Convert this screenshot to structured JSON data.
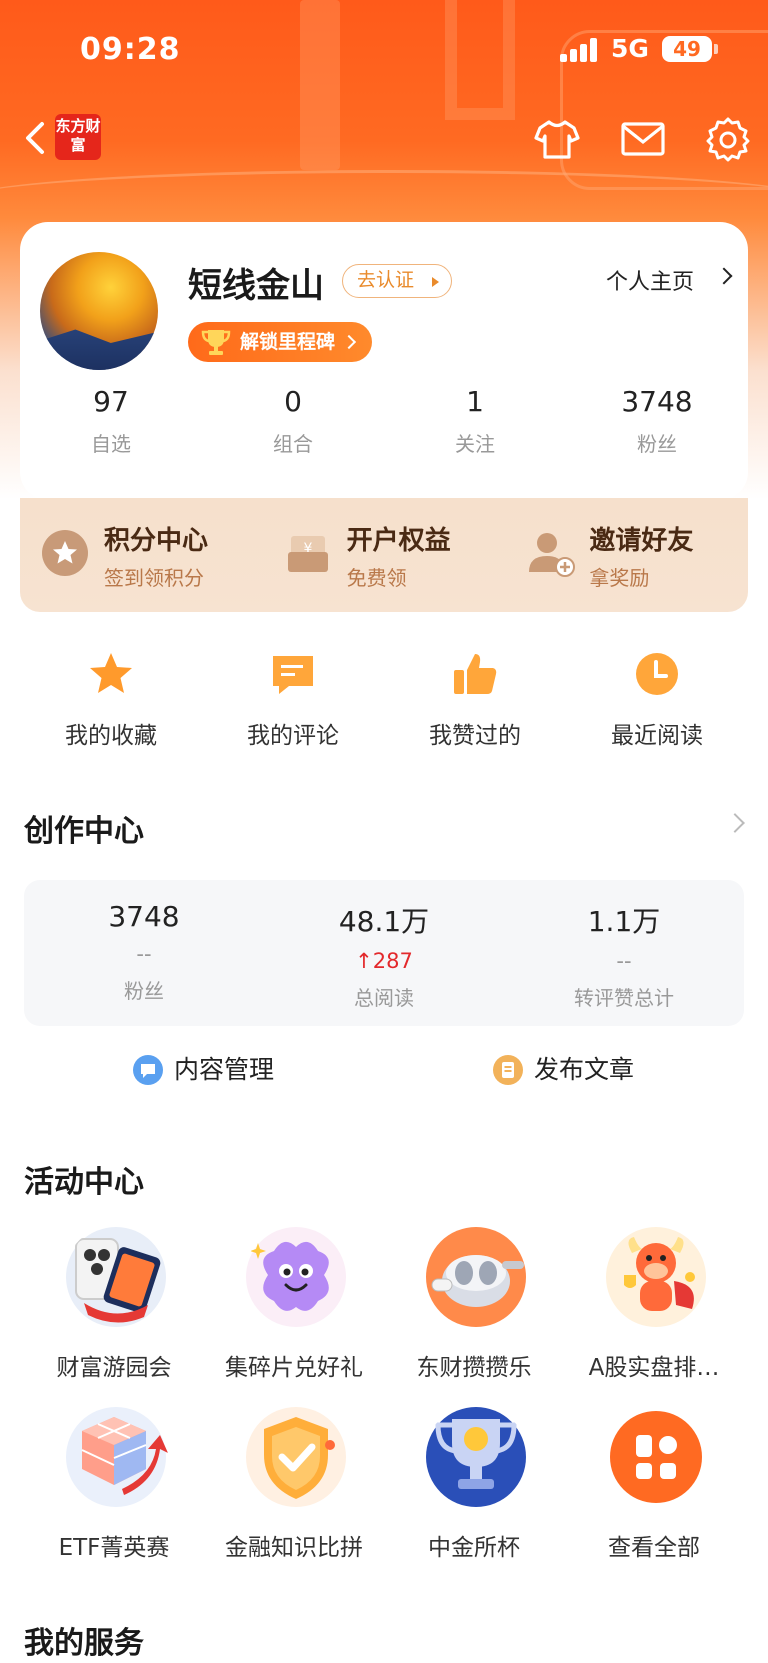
{
  "status_bar": {
    "time": "09:28",
    "network": "5G",
    "battery": "49"
  },
  "nav": {
    "logo_text": "东方财富",
    "icons": [
      "back-icon",
      "tshirt-icon",
      "mail-icon",
      "settings-icon"
    ]
  },
  "profile": {
    "username": "短线金山",
    "verify_label": "去认证",
    "homepage_label": "个人主页",
    "milestone_label": "解锁里程碑",
    "stats": [
      {
        "value": "97",
        "label": "自选"
      },
      {
        "value": "0",
        "label": "组合"
      },
      {
        "value": "1",
        "label": "关注"
      },
      {
        "value": "3748",
        "label": "粉丝"
      }
    ]
  },
  "benefits": [
    {
      "title": "积分中心",
      "sub": "签到领积分",
      "icon": "points-icon"
    },
    {
      "title": "开户权益",
      "sub": "免费领",
      "icon": "gift-box-icon"
    },
    {
      "title": "邀请好友",
      "sub": "拿奖励",
      "icon": "invite-user-icon"
    }
  ],
  "quick_links": [
    {
      "label": "我的收藏",
      "icon": "star-icon"
    },
    {
      "label": "我的评论",
      "icon": "comment-icon"
    },
    {
      "label": "我赞过的",
      "icon": "thumbs-up-icon"
    },
    {
      "label": "最近阅读",
      "icon": "clock-icon"
    }
  ],
  "creator": {
    "title": "创作中心",
    "stats": [
      {
        "value": "3748",
        "delta": "--",
        "label": "粉丝"
      },
      {
        "value": "48.1万",
        "delta": "↑287",
        "label": "总阅读"
      },
      {
        "value": "1.1万",
        "delta": "--",
        "label": "转评赞总计"
      }
    ],
    "actions": [
      {
        "label": "内容管理",
        "color": "#5aa0f0"
      },
      {
        "label": "发布文章",
        "color": "#f2b25a"
      }
    ]
  },
  "activity": {
    "title": "活动中心",
    "items": [
      {
        "label": "财富游园会"
      },
      {
        "label": "集碎片兑好礼"
      },
      {
        "label": "东财攒攒乐"
      },
      {
        "label": "A股实盘排…"
      },
      {
        "label": "ETF菁英赛"
      },
      {
        "label": "金融知识比拼"
      },
      {
        "label": "中金所杯"
      },
      {
        "label": "查看全部"
      }
    ]
  },
  "services": {
    "title": "我的服务"
  },
  "colors": {
    "brand_orange": "#ff6a22",
    "up_red": "#e3292c"
  }
}
